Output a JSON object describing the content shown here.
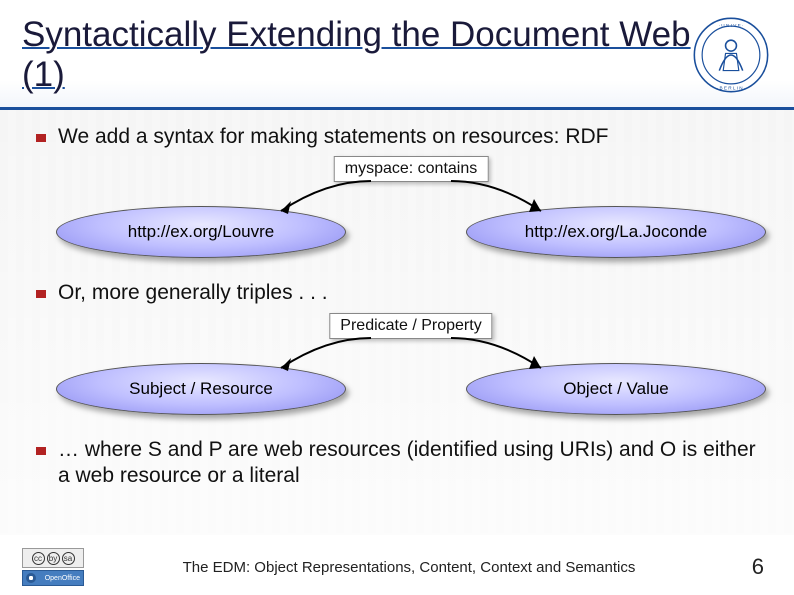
{
  "title": "Syntactically Extending the Document Web (1)",
  "bullets": {
    "b1": "We add a syntax for making statements on resources: RDF",
    "b2": "Or, more generally triples . . .",
    "b3": "… where S and P are web resources (identified using URIs) and O is either a web resource or a literal"
  },
  "diagram1": {
    "predicate": "myspace: contains",
    "subject": "http://ex.org/Louvre",
    "object": "http://ex.org/La.Joconde"
  },
  "diagram2": {
    "predicate": "Predicate / Property",
    "subject": "Subject / Resource",
    "object": "Object / Value"
  },
  "footer": {
    "text": "The EDM: Object Representations, Content, Context and Semantics",
    "page": "6",
    "cc_label": "CC BY-SA",
    "oo_label": "OpenOffice"
  },
  "seal_label": "Humboldt-Universität zu Berlin seal"
}
